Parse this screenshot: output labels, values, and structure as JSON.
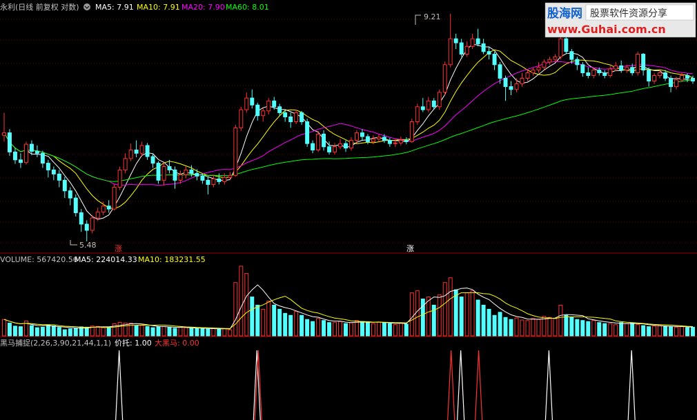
{
  "header": {
    "title": "永利(日线 前复权 对数)",
    "ma5_label": "MA5: 7.91",
    "ma10_label": "MA10: 7.91",
    "ma20_label": "MA20: 7.90",
    "ma60_label": "MA60: 8.01"
  },
  "volume_header": {
    "label": "VOLUME: 567420.56",
    "ma5_label": "MA5: 224014.33",
    "ma10_label": "MA10: 183231.55"
  },
  "indicator_header": {
    "label": "黑马捕捉(2,26,3,90,21,44,1,1)",
    "price_label": "价托: 1.00",
    "big_label": "大黑马: 0.00"
  },
  "watermark": {
    "logo": "股海网",
    "slogan": "股票软件资源分享",
    "url": "www.Guhai.com.cn"
  },
  "price_annotations": {
    "high_label": "9.21",
    "low_label": "5.48",
    "mark_1": "涨",
    "mark_2": "涨"
  },
  "colors": {
    "up": "#ff3232",
    "down": "#54ffff",
    "ma5": "#ffffff",
    "ma10": "#ffff00",
    "ma20": "#ff00ff",
    "ma60": "#00ff00",
    "grid": "#7a0000",
    "text_default": "#c0c0c0",
    "big_label": "#ff3232"
  },
  "chart_data": [
    {
      "type": "candlestick",
      "title": "永利(日线 前复权 对数)",
      "scale": "log",
      "ylim": [
        5.48,
        9.21
      ],
      "annotated_high": 9.21,
      "annotated_low": 5.48,
      "last_moving_averages": {
        "MA5": 7.91,
        "MA10": 7.91,
        "MA20": 7.9,
        "MA60": 8.01
      },
      "series": [
        {
          "name": "MA5",
          "color": "#ffffff"
        },
        {
          "name": "MA10",
          "color": "#ffff00"
        },
        {
          "name": "MA20",
          "color": "#ff00ff"
        },
        {
          "name": "MA60",
          "color": "#00ff00"
        }
      ],
      "candles": [
        [
          6.98,
          7.02,
          7.35,
          6.88
        ],
        [
          7.02,
          6.72,
          7.08,
          6.66
        ],
        [
          6.72,
          6.6,
          6.78,
          6.54
        ],
        [
          6.6,
          6.56,
          6.7,
          6.48
        ],
        [
          6.56,
          6.84,
          6.88,
          6.53
        ],
        [
          6.84,
          6.73,
          6.9,
          6.67
        ],
        [
          6.73,
          6.7,
          6.82,
          6.64
        ],
        [
          6.7,
          6.55,
          6.74,
          6.48
        ],
        [
          6.55,
          6.45,
          6.6,
          6.34
        ],
        [
          6.45,
          6.39,
          6.5,
          6.3
        ],
        [
          6.39,
          6.3,
          6.45,
          6.2
        ],
        [
          6.3,
          6.15,
          6.35,
          6.05
        ],
        [
          6.15,
          6.05,
          6.2,
          5.95
        ],
        [
          6.05,
          5.85,
          6.1,
          5.8
        ],
        [
          5.85,
          5.7,
          5.9,
          5.6
        ],
        [
          5.7,
          5.62,
          5.75,
          5.48
        ],
        [
          5.62,
          5.78,
          5.82,
          5.58
        ],
        [
          5.78,
          5.86,
          5.92,
          5.74
        ],
        [
          5.86,
          5.94,
          6.0,
          5.82
        ],
        [
          5.94,
          5.9,
          6.02,
          5.85
        ],
        [
          5.9,
          6.2,
          6.24,
          5.88
        ],
        [
          6.2,
          6.45,
          6.5,
          6.16
        ],
        [
          6.45,
          6.62,
          6.7,
          6.4
        ],
        [
          6.62,
          6.75,
          6.85,
          6.58
        ],
        [
          6.75,
          6.7,
          6.9,
          6.64
        ],
        [
          6.7,
          6.82,
          6.88,
          6.65
        ],
        [
          6.82,
          6.65,
          6.86,
          6.6
        ],
        [
          6.65,
          6.55,
          6.7,
          6.48
        ],
        [
          6.55,
          6.3,
          6.58,
          6.25
        ],
        [
          6.3,
          6.5,
          6.56,
          6.22
        ],
        [
          6.5,
          6.45,
          6.6,
          6.4
        ],
        [
          6.45,
          6.3,
          6.5,
          6.18
        ],
        [
          6.3,
          6.38,
          6.44,
          6.25
        ],
        [
          6.38,
          6.45,
          6.5,
          6.33
        ],
        [
          6.45,
          6.4,
          6.52,
          6.35
        ],
        [
          6.4,
          6.36,
          6.46,
          6.3
        ],
        [
          6.36,
          6.3,
          6.4,
          6.25
        ],
        [
          6.3,
          6.24,
          6.35,
          6.1
        ],
        [
          6.24,
          6.32,
          6.38,
          6.2
        ],
        [
          6.32,
          6.28,
          6.4,
          6.24
        ],
        [
          6.28,
          6.34,
          6.4,
          6.24
        ],
        [
          6.34,
          6.37,
          6.42,
          6.3
        ],
        [
          6.37,
          7.1,
          7.15,
          6.35
        ],
        [
          7.1,
          7.4,
          7.45,
          7.05
        ],
        [
          7.4,
          7.6,
          7.7,
          7.35
        ],
        [
          7.6,
          7.48,
          7.75,
          7.42
        ],
        [
          7.48,
          7.3,
          7.52,
          7.22
        ],
        [
          7.3,
          7.38,
          7.42,
          7.2
        ],
        [
          7.38,
          7.55,
          7.6,
          7.32
        ],
        [
          7.55,
          7.45,
          7.62,
          7.4
        ],
        [
          7.45,
          7.35,
          7.5,
          7.3
        ],
        [
          7.35,
          7.28,
          7.4,
          7.2
        ],
        [
          7.28,
          7.2,
          7.35,
          7.1
        ],
        [
          7.2,
          7.35,
          7.4,
          7.16
        ],
        [
          7.35,
          7.2,
          7.38,
          7.15
        ],
        [
          7.2,
          6.85,
          7.25,
          6.8
        ],
        [
          6.85,
          6.75,
          6.9,
          6.7
        ],
        [
          6.75,
          7.0,
          7.05,
          6.72
        ],
        [
          7.0,
          6.8,
          7.06,
          6.74
        ],
        [
          6.8,
          6.72,
          6.88,
          6.68
        ],
        [
          6.72,
          6.8,
          6.86,
          6.68
        ],
        [
          6.8,
          6.85,
          6.92,
          6.76
        ],
        [
          6.85,
          6.78,
          6.9,
          6.72
        ],
        [
          6.78,
          6.9,
          6.95,
          6.74
        ],
        [
          6.9,
          7.02,
          7.06,
          6.85
        ],
        [
          7.02,
          6.96,
          7.08,
          6.9
        ],
        [
          6.96,
          6.88,
          7.0,
          6.84
        ],
        [
          6.88,
          6.92,
          6.98,
          6.84
        ],
        [
          6.92,
          6.95,
          7.0,
          6.88
        ],
        [
          6.95,
          6.9,
          7.0,
          6.86
        ],
        [
          6.9,
          6.85,
          6.94,
          6.8
        ],
        [
          6.85,
          6.86,
          6.92,
          6.8
        ],
        [
          6.86,
          6.9,
          6.96,
          6.82
        ],
        [
          6.9,
          6.88,
          6.95,
          6.84
        ],
        [
          6.88,
          7.2,
          7.25,
          6.86
        ],
        [
          7.2,
          7.45,
          7.5,
          7.15
        ],
        [
          7.45,
          7.4,
          7.6,
          7.36
        ],
        [
          7.4,
          7.55,
          7.62,
          7.36
        ],
        [
          7.55,
          7.45,
          7.6,
          7.4
        ],
        [
          7.45,
          7.7,
          7.75,
          7.4
        ],
        [
          7.7,
          8.2,
          8.26,
          7.65
        ],
        [
          8.2,
          8.7,
          9.21,
          8.15
        ],
        [
          8.7,
          8.62,
          8.8,
          8.5
        ],
        [
          8.62,
          8.4,
          8.7,
          8.35
        ],
        [
          8.4,
          8.55,
          8.65,
          8.35
        ],
        [
          8.55,
          8.7,
          8.8,
          8.5
        ],
        [
          8.7,
          8.6,
          8.9,
          8.55
        ],
        [
          8.6,
          8.45,
          8.7,
          8.4
        ],
        [
          8.45,
          8.4,
          8.55,
          8.3
        ],
        [
          8.4,
          8.2,
          8.45,
          8.1
        ],
        [
          8.2,
          7.95,
          8.25,
          7.85
        ],
        [
          7.95,
          7.8,
          8.0,
          7.55
        ],
        [
          7.8,
          7.75,
          7.9,
          7.65
        ],
        [
          7.75,
          7.85,
          7.95,
          7.7
        ],
        [
          7.85,
          7.95,
          8.05,
          7.8
        ],
        [
          7.95,
          8.05,
          8.1,
          7.9
        ],
        [
          8.05,
          8.1,
          8.15,
          8.0
        ],
        [
          8.1,
          8.15,
          8.25,
          8.05
        ],
        [
          8.15,
          8.25,
          8.3,
          8.1
        ],
        [
          8.25,
          8.3,
          8.35,
          8.2
        ],
        [
          8.3,
          8.35,
          8.4,
          8.25
        ],
        [
          8.35,
          8.7,
          8.76,
          8.3
        ],
        [
          8.7,
          8.45,
          8.75,
          8.4
        ],
        [
          8.45,
          8.3,
          8.5,
          8.22
        ],
        [
          8.3,
          8.2,
          8.35,
          8.1
        ],
        [
          8.2,
          8.05,
          8.25,
          7.98
        ],
        [
          8.05,
          8.0,
          8.15,
          7.95
        ],
        [
          8.0,
          8.1,
          8.15,
          7.95
        ],
        [
          8.1,
          8.05,
          8.15,
          8.0
        ],
        [
          8.05,
          8.0,
          8.1,
          7.95
        ],
        [
          8.0,
          8.12,
          8.18,
          7.96
        ],
        [
          8.12,
          8.18,
          8.25,
          8.08
        ],
        [
          8.18,
          8.1,
          8.28,
          8.05
        ],
        [
          8.1,
          8.15,
          8.2,
          8.05
        ],
        [
          8.15,
          8.05,
          8.22,
          8.0
        ],
        [
          8.05,
          8.4,
          8.45,
          8.0
        ],
        [
          8.4,
          8.1,
          8.42,
          8.0
        ],
        [
          8.1,
          7.9,
          8.15,
          7.8
        ],
        [
          7.9,
          8.0,
          8.05,
          7.85
        ],
        [
          8.0,
          8.05,
          8.1,
          7.95
        ],
        [
          8.05,
          7.95,
          8.1,
          7.9
        ],
        [
          7.95,
          7.8,
          8.0,
          7.7
        ],
        [
          7.8,
          7.92,
          7.98,
          7.75
        ],
        [
          7.92,
          8.0,
          8.06,
          7.88
        ],
        [
          8.0,
          7.95,
          8.04,
          7.88
        ],
        [
          7.95,
          7.9,
          8.0,
          7.85
        ]
      ]
    },
    {
      "type": "bar",
      "title": "VOLUME",
      "last_volume": 567420.56,
      "last_ma5": 224014.33,
      "last_ma10": 183231.55,
      "series": [
        {
          "name": "MA5",
          "color": "#ffffff"
        },
        {
          "name": "MA10",
          "color": "#ffff00"
        }
      ],
      "values": [
        160000,
        125000,
        95000,
        90000,
        145000,
        100000,
        80000,
        85000,
        105000,
        98000,
        82000,
        60000,
        70000,
        78000,
        88000,
        85000,
        96000,
        92000,
        80000,
        88000,
        118000,
        132000,
        126000,
        124000,
        98000,
        102000,
        92000,
        80000,
        88000,
        92000,
        86000,
        74000,
        82000,
        80000,
        76000,
        72000,
        70000,
        66000,
        70000,
        68000,
        72000,
        60000,
        520000,
        680000,
        610000,
        380000,
        300000,
        260000,
        340000,
        300000,
        260000,
        220000,
        200000,
        240000,
        200000,
        160000,
        140000,
        170000,
        150000,
        130000,
        130000,
        140000,
        120000,
        128000,
        150000,
        140000,
        130000,
        120000,
        135000,
        130000,
        120000,
        110000,
        125000,
        115000,
        420000,
        440000,
        360000,
        380000,
        300000,
        400000,
        520000,
        567420,
        450000,
        380000,
        420000,
        440000,
        350000,
        300000,
        260000,
        200000,
        230000,
        180000,
        160000,
        175000,
        155000,
        150000,
        170000,
        160000,
        190000,
        180000,
        170000,
        300000,
        200000,
        180000,
        160000,
        150000,
        140000,
        150000,
        130000,
        120000,
        120000,
        110000,
        130000,
        120000,
        125000,
        110000,
        100000,
        90000,
        95000,
        100000,
        95000,
        88000,
        85000,
        90000,
        80000,
        85000
      ]
    },
    {
      "type": "line",
      "title": "黑马捕捉(2,26,3,90,21,44,1,1)",
      "series": [
        {
          "name": "价托",
          "last_value": 1.0,
          "color": "#ffffff",
          "spikes_at_bar": [
            21,
            46,
            83,
            99,
            114
          ]
        },
        {
          "name": "大黑马",
          "last_value": 0.0,
          "color": "#ff3232",
          "spikes_at_bar": [
            46,
            81,
            86
          ]
        }
      ]
    }
  ]
}
